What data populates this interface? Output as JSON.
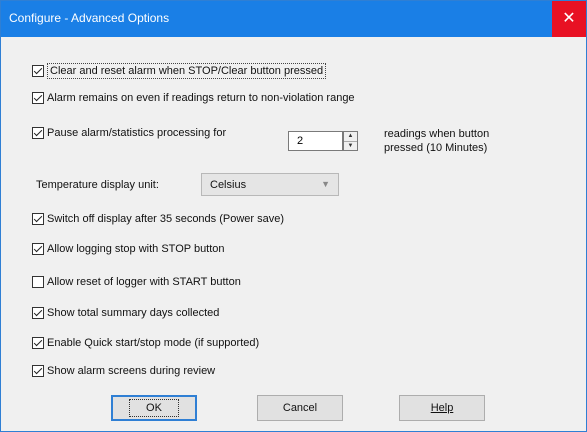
{
  "window": {
    "title": "Configure - Advanced Options",
    "close_glyph": "✕"
  },
  "options": [
    {
      "label": "Clear and reset alarm when STOP/Clear button pressed",
      "checked": true
    },
    {
      "label": "Alarm remains on even if readings return to non-violation range",
      "checked": true
    },
    {
      "label": "Pause alarm/statistics processing for",
      "checked": true
    },
    {
      "label": "Switch off display after 35 seconds (Power save)",
      "checked": true
    },
    {
      "label": "Allow logging stop with STOP button",
      "checked": true
    },
    {
      "label": "Allow reset of logger with START button",
      "checked": false
    },
    {
      "label": "Show total summary days collected",
      "checked": true
    },
    {
      "label": "Enable Quick start/stop mode (if supported)",
      "checked": true
    },
    {
      "label": "Show alarm screens during review",
      "checked": true
    }
  ],
  "pause": {
    "value": "2",
    "suffix_line1": "readings when button",
    "suffix_line2": "pressed (10 Minutes)"
  },
  "temperature": {
    "label": "Temperature display unit:",
    "selected": "Celsius"
  },
  "buttons": {
    "ok": "OK",
    "cancel": "Cancel",
    "help": "Help"
  },
  "icons": {
    "close": "close-icon",
    "spin_up": "spin-up-icon",
    "spin_down": "spin-down-icon",
    "dropdown": "chevron-down-icon"
  },
  "colors": {
    "titlebar": "#1a7fe6",
    "close": "#e81123",
    "dialog_bg": "#f0f0f0"
  }
}
